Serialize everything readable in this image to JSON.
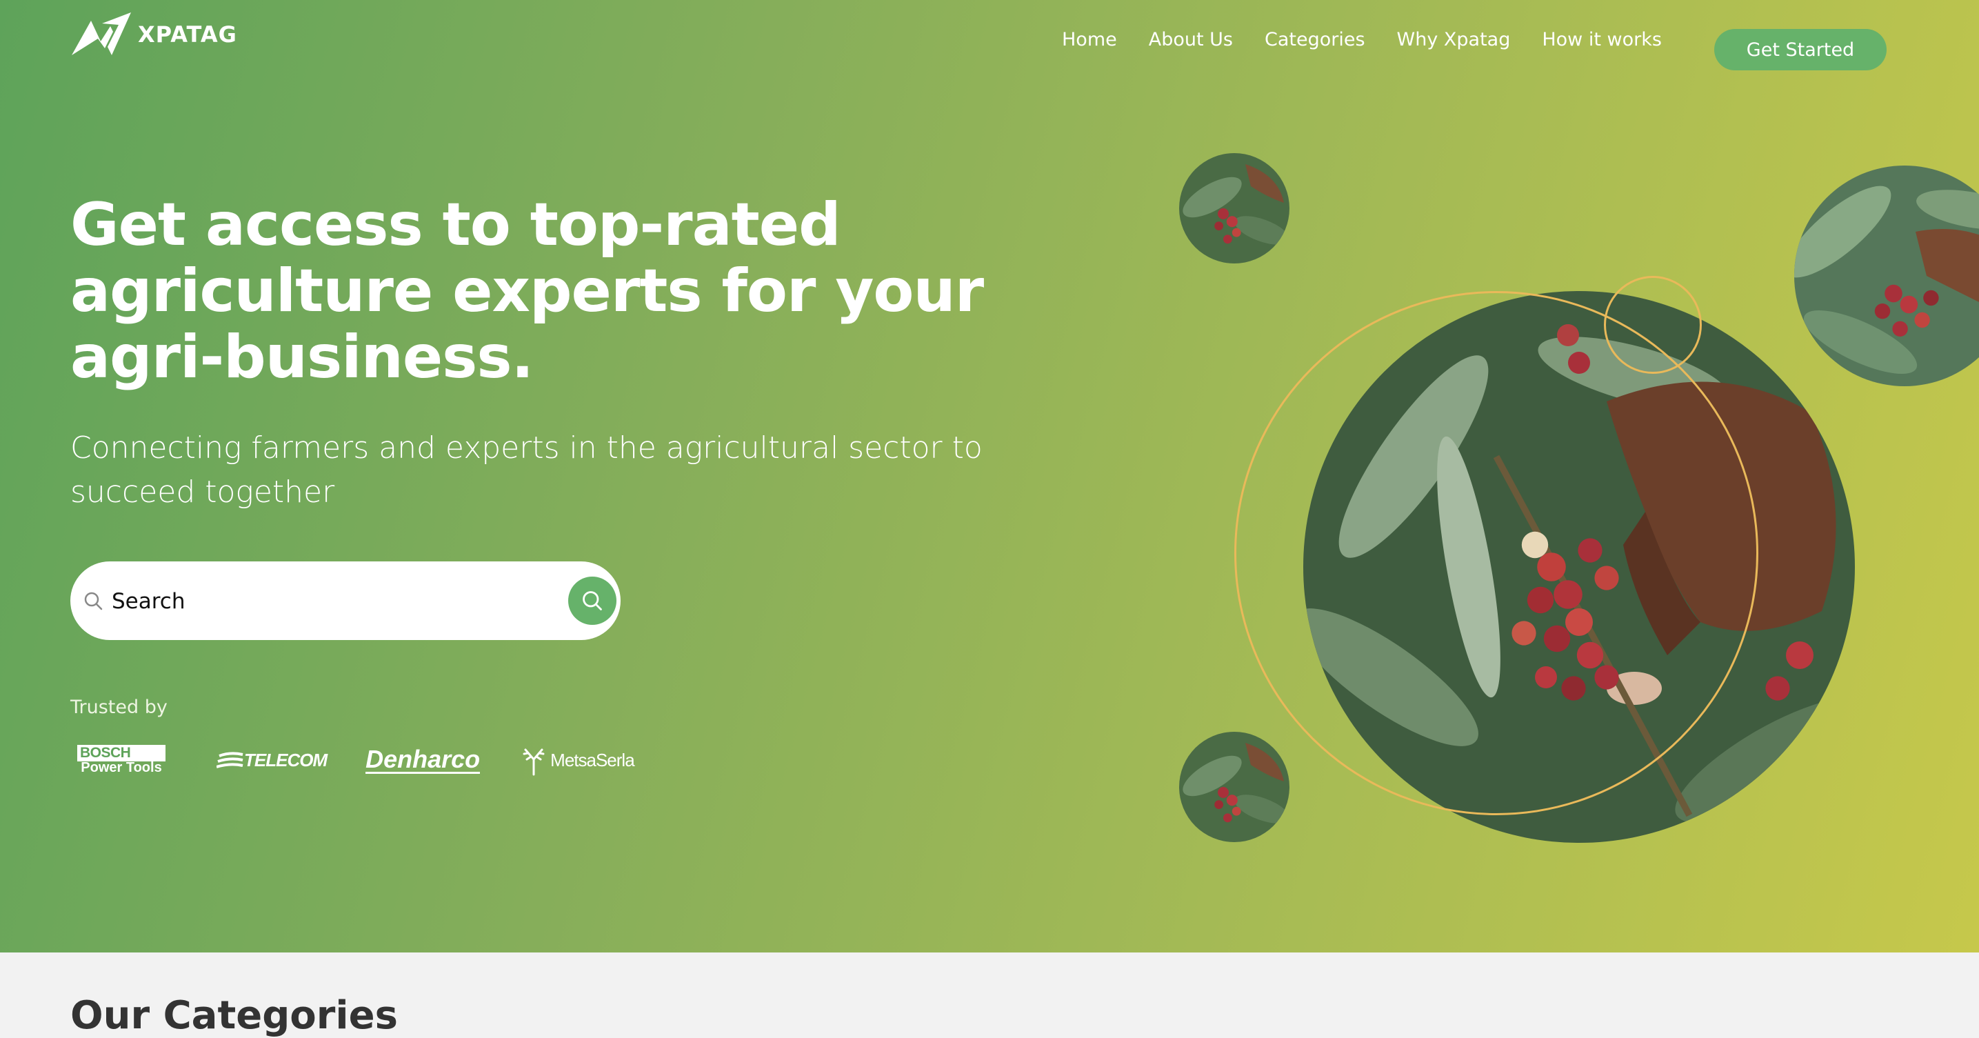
{
  "brand": {
    "name": "XPATAG"
  },
  "nav": {
    "items": [
      "Home",
      "About Us",
      "Categories",
      "Why Xpatag",
      "How it works"
    ],
    "cta": "Get Started"
  },
  "hero": {
    "headline": "Get access to top-rated agriculture experts for your agri-business.",
    "subheadline": "Connecting farmers and experts in the agricultural sector to succeed together",
    "search_placeholder": "Search"
  },
  "trusted": {
    "label": "Trusted by",
    "logos": {
      "bosch_main": "BOSCH",
      "bosch_sub": "Power Tools",
      "telecom": "TELECOM",
      "denharco": "Denharco",
      "metsa": "MetsaSerla"
    }
  },
  "categories": {
    "title": "Our Categories"
  },
  "colors": {
    "accent": "#66b26a",
    "ring": "#e9b95a",
    "gradient_start": "#5ea35a",
    "gradient_end": "#c6c84b"
  }
}
